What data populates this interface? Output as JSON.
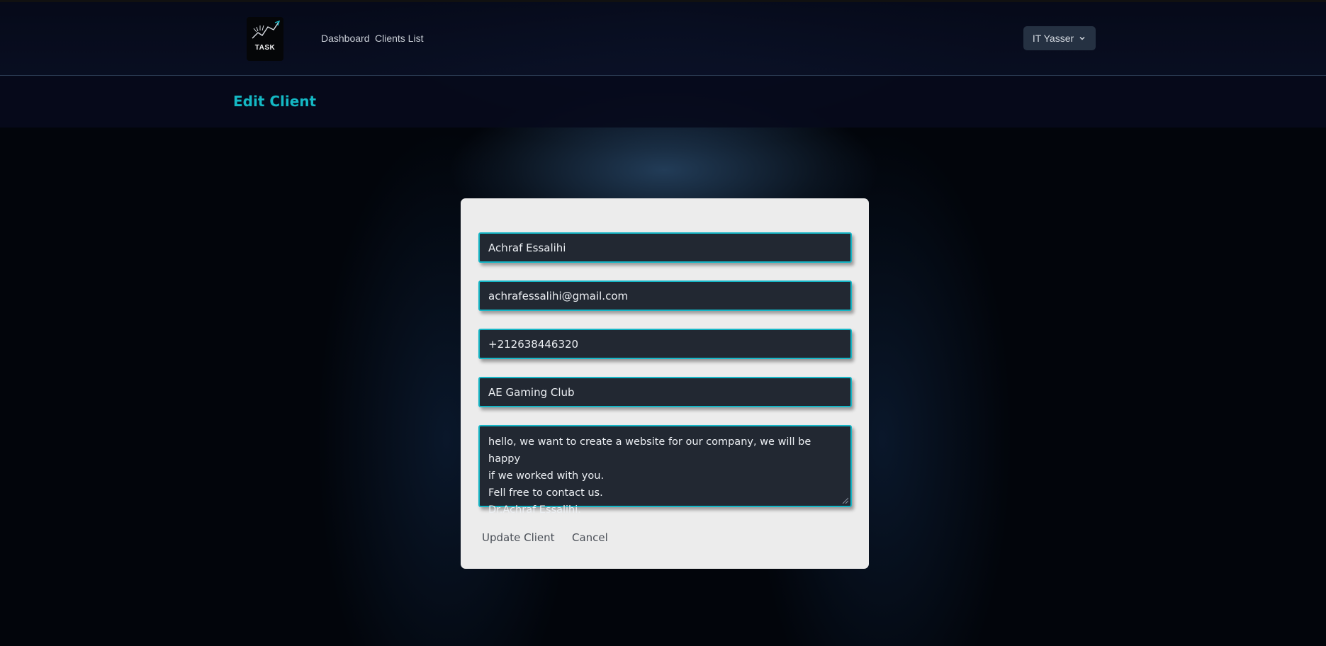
{
  "nav": {
    "logo_text": "TASK",
    "links": [
      {
        "label": "Dashboard"
      },
      {
        "label": "Clients List"
      }
    ],
    "user": {
      "label": "IT Yasser"
    }
  },
  "header": {
    "title": "Edit Client"
  },
  "form": {
    "name": "Achraf Essalihi",
    "email": "achrafessalihi@gmail.com",
    "phone": "+212638446320",
    "company": "AE Gaming Club",
    "message_lines": [
      "hello, we want to create a website for our company, we will be happy",
      "if we worked with you.",
      "Fell free to contact us.",
      "Dr.Achraf Essalihi."
    ],
    "update_label": "Update Client",
    "cancel_label": "Cancel"
  },
  "colors": {
    "accent": "#14b8c4",
    "field_bg": "#222832",
    "card_bg": "#ececec"
  }
}
